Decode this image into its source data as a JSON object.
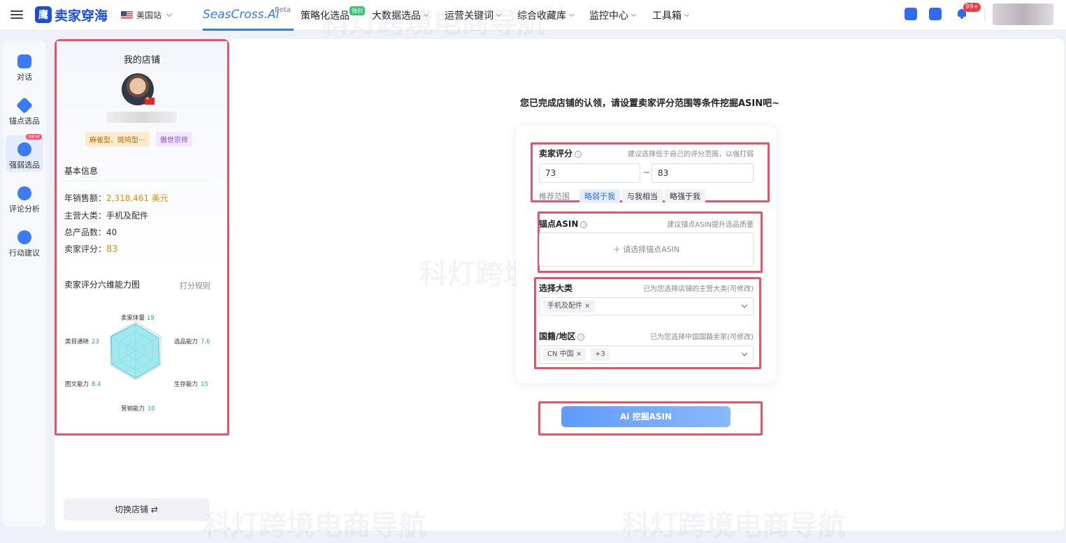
{
  "topbar": {
    "menu_icon": "hamburger-icon",
    "logo_mark": "鹰",
    "logo_text": "卖家穿海",
    "site_label": "美国站",
    "brand": "SeasCross.Ai",
    "brand_beta": "Beta",
    "nav": [
      {
        "label": "策略化选品",
        "badge": "独创"
      },
      {
        "label": "大数据选品"
      },
      {
        "label": "运营关键词"
      },
      {
        "label": "综合收藏库"
      },
      {
        "label": "监控中心"
      },
      {
        "label": "工具箱"
      }
    ],
    "notif_count": "99+"
  },
  "rail": {
    "items": [
      {
        "label": "对话",
        "icon": "chat-bot-icon"
      },
      {
        "label": "锚点选品",
        "icon": "anchor-cube-icon"
      },
      {
        "label": "强弱选品",
        "icon": "user-compare-icon",
        "badge": "NEW"
      },
      {
        "label": "评论分析",
        "icon": "review-icon"
      },
      {
        "label": "行动建议",
        "icon": "compass-icon"
      }
    ]
  },
  "shop": {
    "title": "我的店铺",
    "tag_a": "麻雀型、斑鸠型···",
    "tag_b": "傲世宗师",
    "basic_title": "基本信息",
    "rows": [
      {
        "label": "年销售额：",
        "value": "2,318,461 美元"
      },
      {
        "label": "主营大类：",
        "value": "手机及配件"
      },
      {
        "label": "总产品数：",
        "value": "40"
      },
      {
        "label": "卖家评分：",
        "value": "83"
      }
    ],
    "radar_title": "卖家评分六维能力图",
    "rule_link": "打分规则",
    "radar_labels": [
      {
        "name": "卖家体量",
        "value": "19"
      },
      {
        "name": "选品能力",
        "value": "7.6"
      },
      {
        "name": "生存能力",
        "value": "15"
      },
      {
        "name": "营销能力",
        "value": "10"
      },
      {
        "name": "图文能力",
        "value": "8.4"
      },
      {
        "name": "类目通晓",
        "value": "23"
      }
    ],
    "switch_label": "切换店铺 ⇄"
  },
  "main": {
    "prompt": "您已完成店铺的认领，请设置卖家评分范围等条件挖掘ASIN吧~",
    "rating": {
      "label": "卖家评分",
      "hint": "建议选择低于自己的评分范围，以强打弱",
      "min": "73",
      "max": "83",
      "tilde": "~",
      "rec_label": "推荐范围",
      "options": [
        "略弱于我",
        "与我相当",
        "略强于我"
      ],
      "selected": "略弱于我"
    },
    "anchor": {
      "label": "锚点ASIN",
      "hint": "建议锚点ASIN提升选品质量",
      "placeholder": "＋ 请选择锚点ASIN"
    },
    "category": {
      "label": "选择大类",
      "hint": "已为您选择店铺的主营大类(可修改)",
      "chip": "手机及配件 ×"
    },
    "country": {
      "label": "国籍/地区",
      "hint": "已为您选择中国国籍卖家(可修改)",
      "chip": "CN 中国 ×",
      "more": "+3"
    },
    "mine_button": "Ai  挖掘ASIN"
  },
  "watermark": "科灯跨境电商导航"
}
